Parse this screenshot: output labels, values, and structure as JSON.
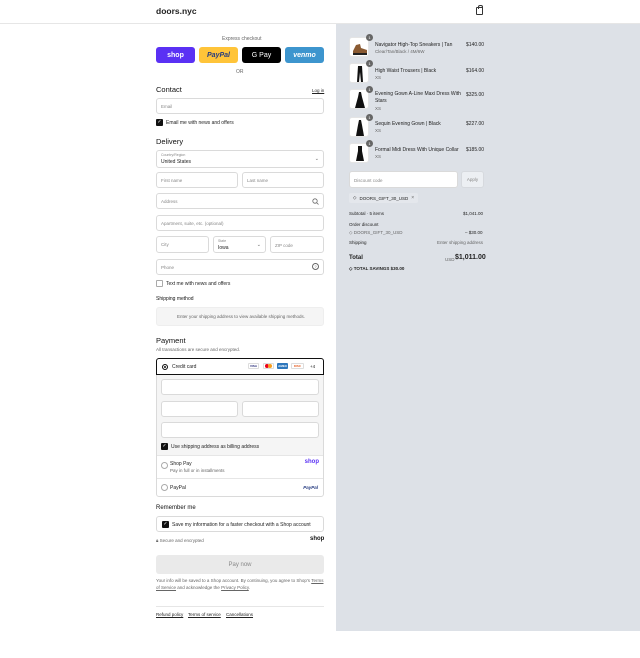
{
  "header": {
    "store_name": "doors.nyc"
  },
  "express": {
    "title": "Express checkout",
    "shop": "shop",
    "paypal": "PayPal",
    "gpay": "G Pay",
    "venmo": "venmo",
    "or": "OR"
  },
  "contact": {
    "title": "Contact",
    "login": "Log in",
    "email_placeholder": "Email",
    "news_label": "Email me with news and offers"
  },
  "delivery": {
    "title": "Delivery",
    "country_label": "Country/Region",
    "country_value": "United States",
    "first_name": "First name",
    "last_name": "Last name",
    "address": "Address",
    "apartment": "Apartment, suite, etc. (optional)",
    "city": "City",
    "state_label": "State",
    "state_value": "Iowa",
    "zip": "ZIP code",
    "phone": "Phone",
    "text_label": "Text me with news and offers"
  },
  "shipping_method": {
    "title": "Shipping method",
    "message": "Enter your shipping address to view available shipping methods."
  },
  "payment": {
    "title": "Payment",
    "subtitle": "All transactions are secure and encrypted.",
    "credit_card": "Credit card",
    "more_cards": "+4",
    "card_brands": [
      "VISA",
      "MC",
      "AMEX",
      "DISC"
    ],
    "billing_label": "Use shipping address as billing address",
    "shop_pay": "Shop Pay",
    "shop_pay_sub": "Pay in full or in installments",
    "shop_pay_logo": "shop",
    "paypal": "PayPal",
    "paypal_logo": "PayPal"
  },
  "remember": {
    "title": "Remember me",
    "save_label": "Save my information for a faster checkout with a Shop account",
    "secure": "Secure and encrypted",
    "shop_logo": "shop"
  },
  "pay_now": "Pay now",
  "legal": {
    "prefix": "Your info will be saved to a Shop account. By continuing, you agree to Shop's",
    "terms": "Terms of Service",
    "mid": "and acknowledge the",
    "privacy": "Privacy Policy",
    "end": "."
  },
  "footer": {
    "refund": "Refund policy",
    "terms": "Terms of service",
    "cancel": "Cancellations"
  },
  "summary": {
    "items": [
      {
        "name": "Navigator High-Top Sneakers | Tan",
        "variant": "Clear/Tan/Black / 4M/6W",
        "price": "$140.00",
        "qty": "1"
      },
      {
        "name": "High Waist Trousers | Black",
        "variant": "XS",
        "price": "$164.00",
        "qty": "1"
      },
      {
        "name": "Evening Gown A-Line Maxi Dress With Stars",
        "variant": "XS",
        "price": "$325.00",
        "qty": "1"
      },
      {
        "name": "Sequin Evening Gown | Black",
        "variant": "XS",
        "price": "$227.00",
        "qty": "1"
      },
      {
        "name": "Formal Midi Dress With Unique Collar",
        "variant": "XS",
        "price": "$185.00",
        "qty": "1"
      }
    ],
    "discount_placeholder": "Discount code",
    "apply": "Apply",
    "tag": "DOORS_GIFT_30_USD",
    "subtotal_label": "Subtotal · 5 items",
    "subtotal": "$1,041.00",
    "order_discount": "Order discount",
    "discount_code": "DOORS_GIFT_30_USD",
    "discount_value": "– $30.00",
    "shipping_label": "Shipping",
    "shipping_value": "Enter shipping address",
    "total_label": "Total",
    "currency": "USD",
    "total": "$1,011.00",
    "savings_label": "TOTAL SAVINGS",
    "savings": "$30.00"
  }
}
